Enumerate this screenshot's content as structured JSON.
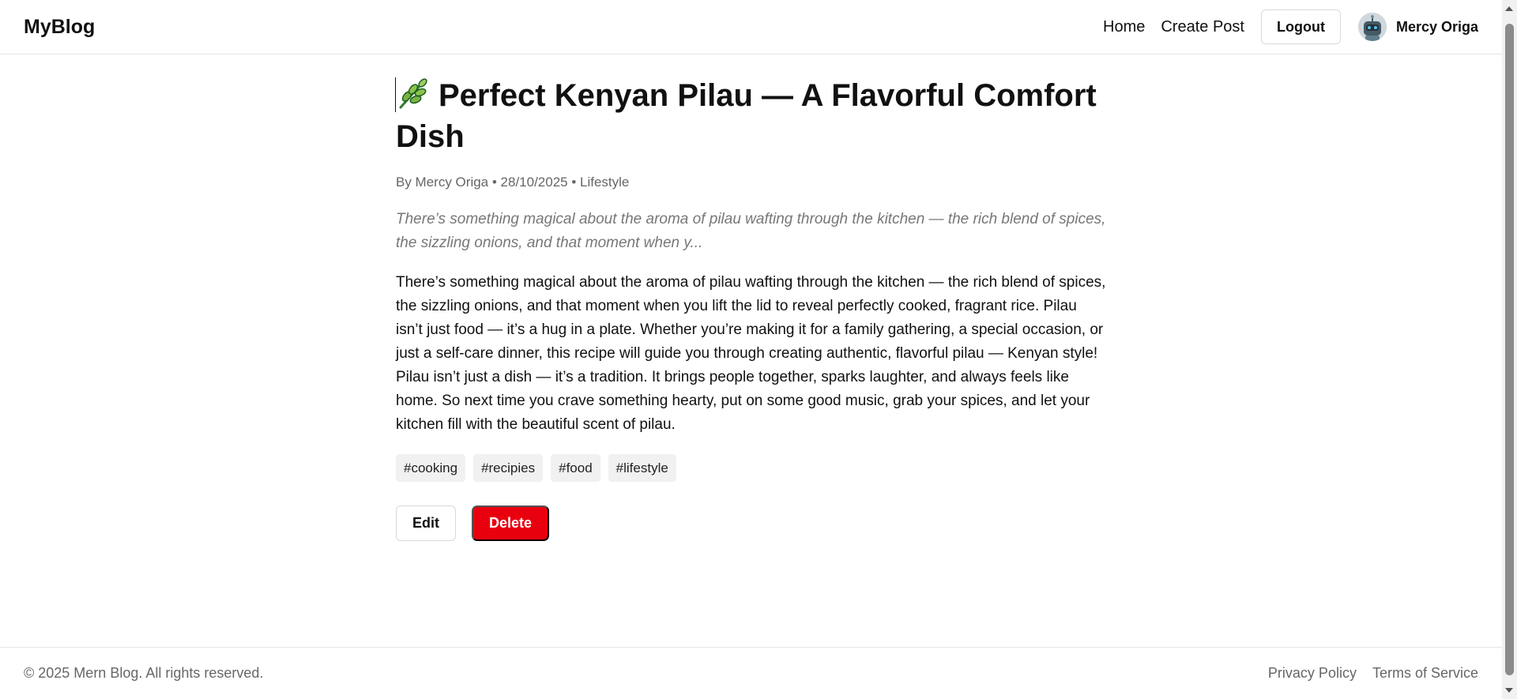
{
  "header": {
    "brand": "MyBlog",
    "nav": [
      {
        "label": "Home"
      },
      {
        "label": "Create Post"
      }
    ],
    "logout_label": "Logout",
    "user": {
      "name": "Mercy Origa",
      "avatar_icon": "robot-avatar-icon"
    }
  },
  "post": {
    "title_icon": "leaf-icon",
    "title": "Perfect Kenyan Pilau — A Flavorful Comfort Dish",
    "meta": "By Mercy Origa • 28/10/2025 • Lifestyle",
    "excerpt": "There’s something magical about the aroma of pilau wafting through the kitchen — the rich blend of spices, the sizzling onions, and that moment when y...",
    "body": "There’s something magical about the aroma of pilau wafting through the kitchen — the rich blend of spices, the sizzling onions, and that moment when you lift the lid to reveal perfectly cooked, fragrant rice. Pilau isn’t just food — it’s a hug in a plate. Whether you’re making it for a family gathering, a special occasion, or just a self-care dinner, this recipe will guide you through creating authentic, flavorful pilau — Kenyan style! Pilau isn’t just a dish — it’s a tradition. It brings people together, sparks laughter, and always feels like home. So next time you crave something hearty, put on some good music, grab your spices, and let your kitchen fill with the beautiful scent of pilau.",
    "tags": [
      "#cooking",
      "#recipies",
      "#food",
      "#lifestyle"
    ],
    "edit_label": "Edit",
    "delete_label": "Delete",
    "delete_color": "#e8000f"
  },
  "footer": {
    "copyright": "© 2025 Mern Blog. All rights reserved.",
    "links": [
      {
        "label": "Privacy Policy"
      },
      {
        "label": "Terms of Service"
      }
    ]
  }
}
